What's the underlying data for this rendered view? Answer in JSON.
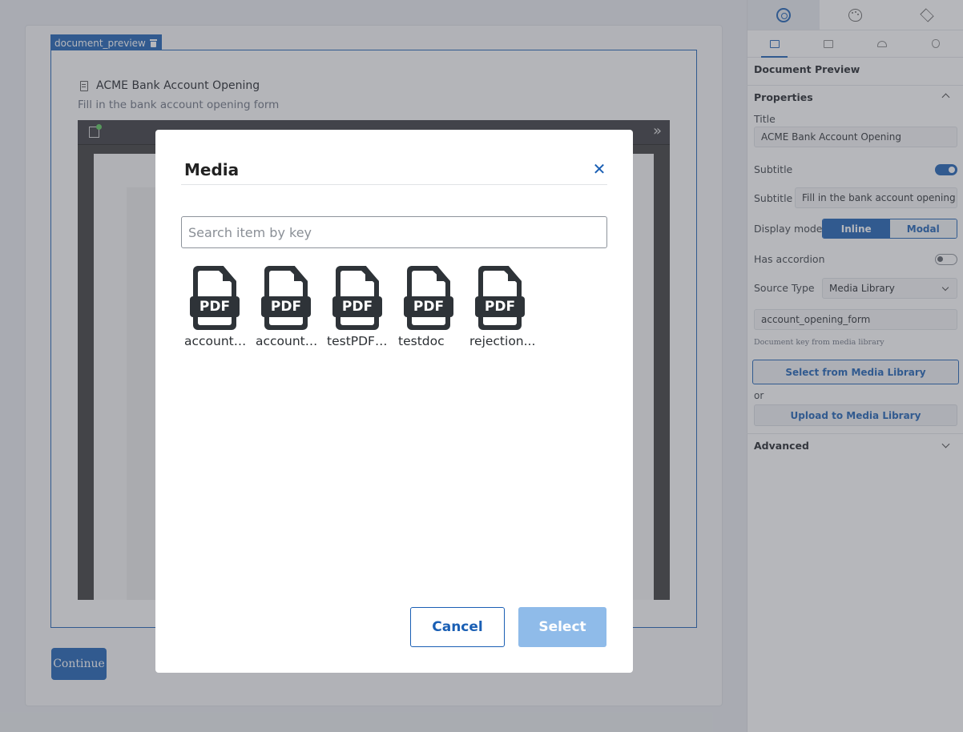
{
  "canvas": {
    "component_tag": "document_preview",
    "doc_title": "ACME Bank Account Opening",
    "doc_subtitle": "Fill in the bank account opening form",
    "continue_label": "Continue"
  },
  "panel": {
    "top_tabs": [
      "gear-icon",
      "palette-icon",
      "layers-icon"
    ],
    "sub_tabs": [
      "tablet-icon",
      "desktop-icon",
      "android-icon",
      "apple-icon"
    ],
    "heading": "Document Preview",
    "properties_label": "Properties",
    "title_label": "Title",
    "title_value": "ACME Bank Account Opening",
    "subtitle_toggle_label": "Subtitle",
    "subtitle_toggle_on": true,
    "subtitle_label": "Subtitle",
    "subtitle_value": "Fill in the bank account opening f",
    "display_mode_label": "Display mode",
    "display_mode_options": [
      "Inline",
      "Modal"
    ],
    "display_mode_selected": "Inline",
    "has_accordion_label": "Has accordion",
    "has_accordion_on": false,
    "source_type_label": "Source Type",
    "source_type_value": "Media Library",
    "document_key_value": "account_opening_form",
    "document_key_hint": "Document key from media library",
    "select_media_label": "Select from Media Library",
    "or_label": "or",
    "upload_media_label": "Upload to Media Library",
    "advanced_label": "Advanced"
  },
  "modal": {
    "title": "Media",
    "close_icon": "close-icon",
    "search_placeholder": "Search item by key",
    "files": [
      {
        "name": "account_...",
        "badge": "PDF"
      },
      {
        "name": "account_...",
        "badge": "PDF"
      },
      {
        "name": "testPDFn...",
        "badge": "PDF"
      },
      {
        "name": "testdoc",
        "badge": "PDF"
      },
      {
        "name": "rejection...",
        "badge": "PDF"
      }
    ],
    "cancel_label": "Cancel",
    "select_label": "Select"
  },
  "colors": {
    "accent": "#1a5fb4",
    "select_disabled": "#8fbbe9",
    "pdf_icon": "#2e3338"
  }
}
